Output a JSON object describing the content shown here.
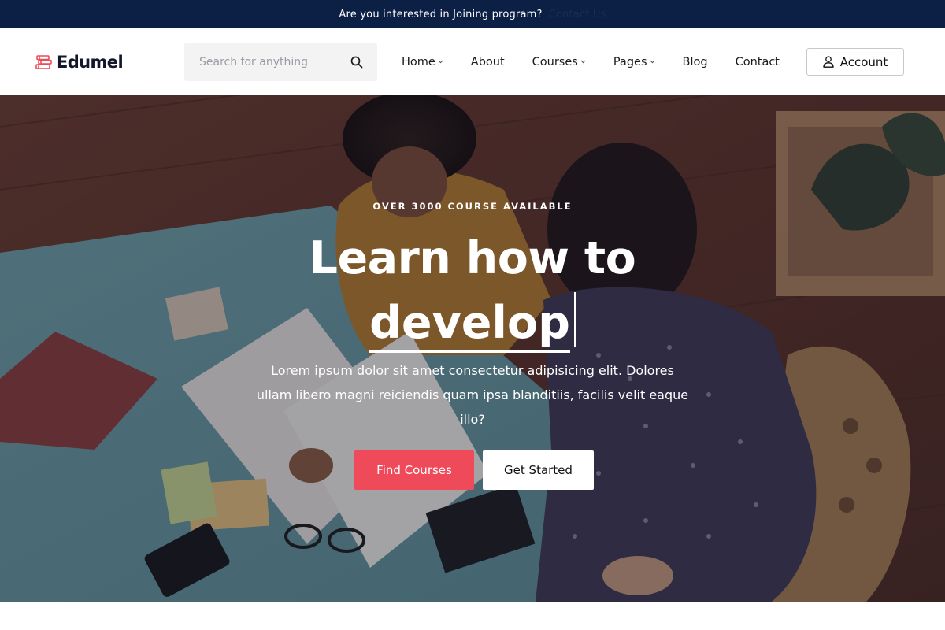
{
  "topbar": {
    "text": "Are you interested in Joining program?",
    "link_label": "Contact Us"
  },
  "brand": {
    "name": "Edumel",
    "accent_color": "#ef4a5a",
    "logo_icon": "books-icon"
  },
  "search": {
    "placeholder": "Search for anything",
    "value": "",
    "icon": "search-icon"
  },
  "nav": {
    "items": [
      {
        "label": "Home",
        "has_dropdown": true
      },
      {
        "label": "About",
        "has_dropdown": false
      },
      {
        "label": "Courses",
        "has_dropdown": true
      },
      {
        "label": "Pages",
        "has_dropdown": true
      },
      {
        "label": "Blog",
        "has_dropdown": false
      },
      {
        "label": "Contact",
        "has_dropdown": false
      }
    ],
    "account_label": "Account"
  },
  "hero": {
    "kicker": "OVER 3000 COURSE AVAILABLE",
    "headline_line1": "Learn how to",
    "headline_word": "develop",
    "description": "Lorem ipsum dolor sit amet consectetur adipisicing elit. Dolores ullam libero magni reiciendis quam ipsa blanditiis, facilis velit eaque illo?",
    "primary_button": "Find Courses",
    "secondary_button": "Get Started"
  },
  "colors": {
    "topbar_bg": "#0c1f45",
    "primary_button": "#ef4a5a"
  }
}
